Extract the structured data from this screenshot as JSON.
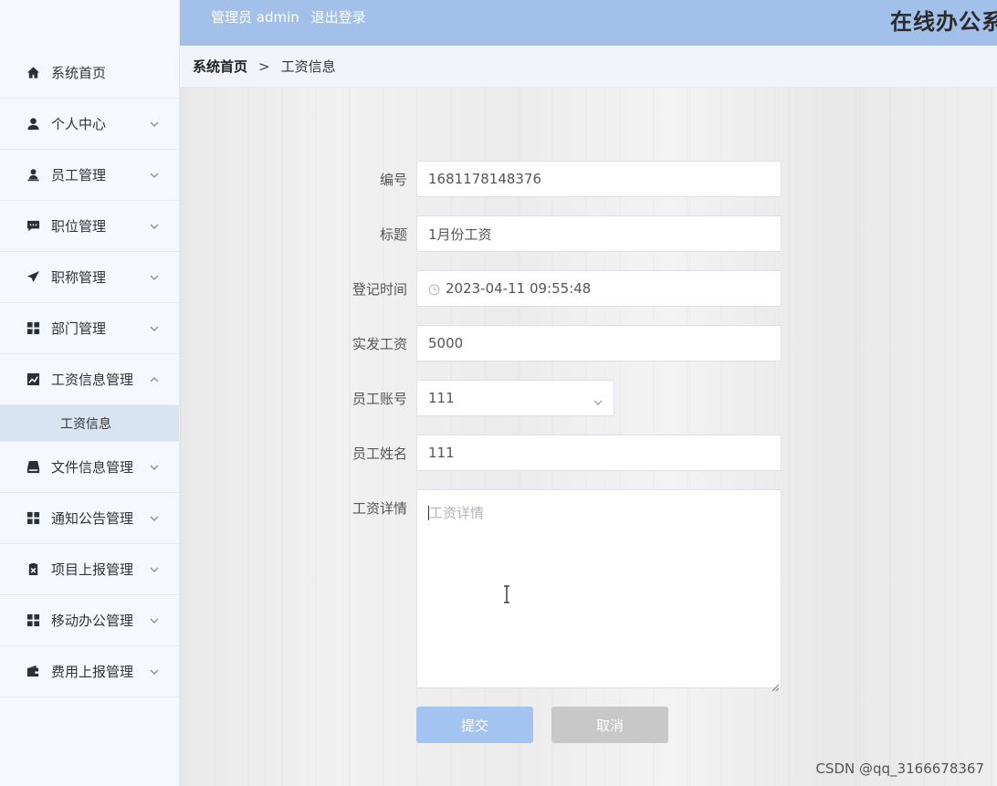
{
  "header": {
    "user_prefix": "管理员 admin",
    "logout_label": "退出登录",
    "system_title": "在线办公系"
  },
  "breadcrumb": {
    "home": "系统首页",
    "separator": ">",
    "current": "工资信息"
  },
  "sidebar": {
    "items": [
      {
        "label": "系统首页",
        "icon": "home-icon",
        "expandable": false
      },
      {
        "label": "个人中心",
        "icon": "user-icon",
        "expandable": true
      },
      {
        "label": "员工管理",
        "icon": "employee-icon",
        "expandable": true
      },
      {
        "label": "职位管理",
        "icon": "message-icon",
        "expandable": true
      },
      {
        "label": "职称管理",
        "icon": "send-icon",
        "expandable": true
      },
      {
        "label": "部门管理",
        "icon": "grid-icon",
        "expandable": true
      },
      {
        "label": "工资信息管理",
        "icon": "chart-icon",
        "expandable": true,
        "expanded": true
      },
      {
        "label": "文件信息管理",
        "icon": "inbox-icon",
        "expandable": true
      },
      {
        "label": "通知公告管理",
        "icon": "grid-icon",
        "expandable": true
      },
      {
        "label": "项目上报管理",
        "icon": "clipboard-icon",
        "expandable": true
      },
      {
        "label": "移动办公管理",
        "icon": "grid-icon",
        "expandable": true
      },
      {
        "label": "费用上报管理",
        "icon": "wallet-icon",
        "expandable": true
      }
    ],
    "active_subitem": "工资信息"
  },
  "form": {
    "number": {
      "label": "编号",
      "value": "1681178148376"
    },
    "title": {
      "label": "标题",
      "value": "1月份工资"
    },
    "register_time": {
      "label": "登记时间",
      "value": "2023-04-11 09:55:48"
    },
    "actual_salary": {
      "label": "实发工资",
      "value": "5000"
    },
    "employee_account": {
      "label": "员工账号",
      "value": "111"
    },
    "employee_name": {
      "label": "员工姓名",
      "value": "111"
    },
    "salary_details": {
      "label": "工资详情",
      "placeholder": "工资详情",
      "value": ""
    },
    "submit_label": "提交",
    "cancel_label": "取消"
  },
  "watermark": "CSDN @qq_3166678367",
  "colors": {
    "header_bg": "#a3c0ea",
    "submit_bg": "#a3c3f0",
    "cancel_bg": "#c8c8c8",
    "active_sub_bg": "#d9e4f2"
  }
}
